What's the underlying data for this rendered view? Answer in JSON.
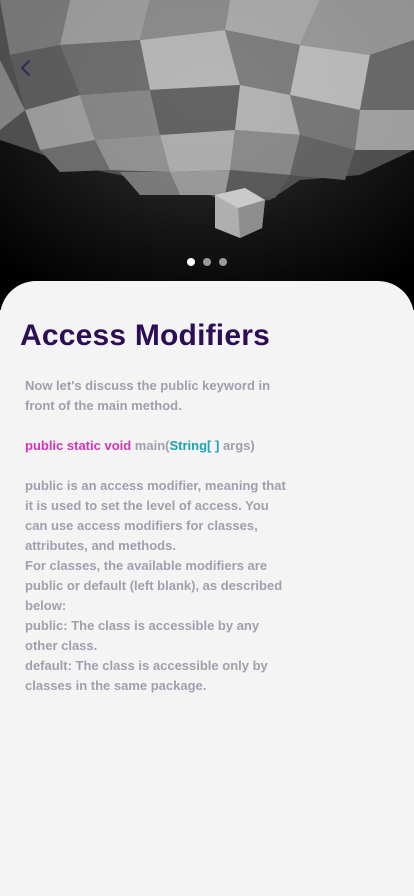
{
  "nav": {
    "back_icon": "chevron-left-icon"
  },
  "hero": {
    "image": "abstract-3d-cubes",
    "pager": {
      "count": 3,
      "active_index": 0
    }
  },
  "content": {
    "title": "Access Modifiers",
    "intro": "Now let's discuss the public keyword in front of the main method.",
    "code": {
      "keywords": "public static void",
      "method_open": " main(",
      "type": "String",
      "brackets": "[  ]",
      "rest": " args)"
    },
    "paragraphs": [
      "public is an access modifier, meaning that it is used to set the level of access. You can use access modifiers for classes, attributes, and methods.",
      "For classes, the available modifiers are public or default (left blank), as described below:",
      "public: The class is accessible by any other class.",
      "default: The class is accessible only by classes in the same package."
    ]
  },
  "colors": {
    "title": "#2d0d55",
    "body_text": "#a29eae",
    "keyword": "#d633b8",
    "type": "#1aa3b5",
    "background": "#f4f4f4"
  }
}
